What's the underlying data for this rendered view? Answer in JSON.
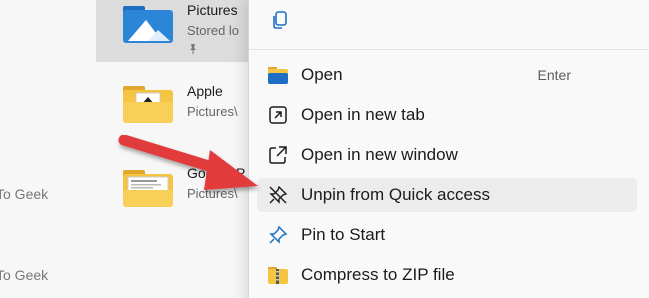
{
  "explorer": {
    "left_labels": [
      "To Geek",
      "To Geek"
    ],
    "quick_access": [
      {
        "name": "Pictures",
        "path": "Stored lo",
        "pinned": true,
        "selected": true,
        "folder_type": "pictures"
      },
      {
        "name": "Apple",
        "path": "Pictures\\",
        "pinned": false,
        "selected": false,
        "folder_type": "yellow-image"
      },
      {
        "name": "Google P",
        "path": "Pictures\\",
        "pinned": false,
        "selected": false,
        "folder_type": "yellow-doc"
      }
    ]
  },
  "context_menu": {
    "top_icon": "copy-icon",
    "items": [
      {
        "label": "Open",
        "shortcut": "Enter",
        "icon": "folder-icon"
      },
      {
        "label": "Open in new tab",
        "shortcut": "",
        "icon": "open-new-tab-icon"
      },
      {
        "label": "Open in new window",
        "shortcut": "",
        "icon": "open-new-window-icon"
      },
      {
        "label": "Unpin from Quick access",
        "shortcut": "",
        "icon": "unpin-icon",
        "highlighted": true
      },
      {
        "label": "Pin to Start",
        "shortcut": "",
        "icon": "pin-icon"
      },
      {
        "label": "Compress to ZIP file",
        "shortcut": "",
        "icon": "zip-icon"
      }
    ]
  },
  "colors": {
    "accent": "#0f6cbd",
    "arrow": "#e23b3b",
    "folder_yellow": "#f5c542",
    "hover": "#ececec"
  }
}
